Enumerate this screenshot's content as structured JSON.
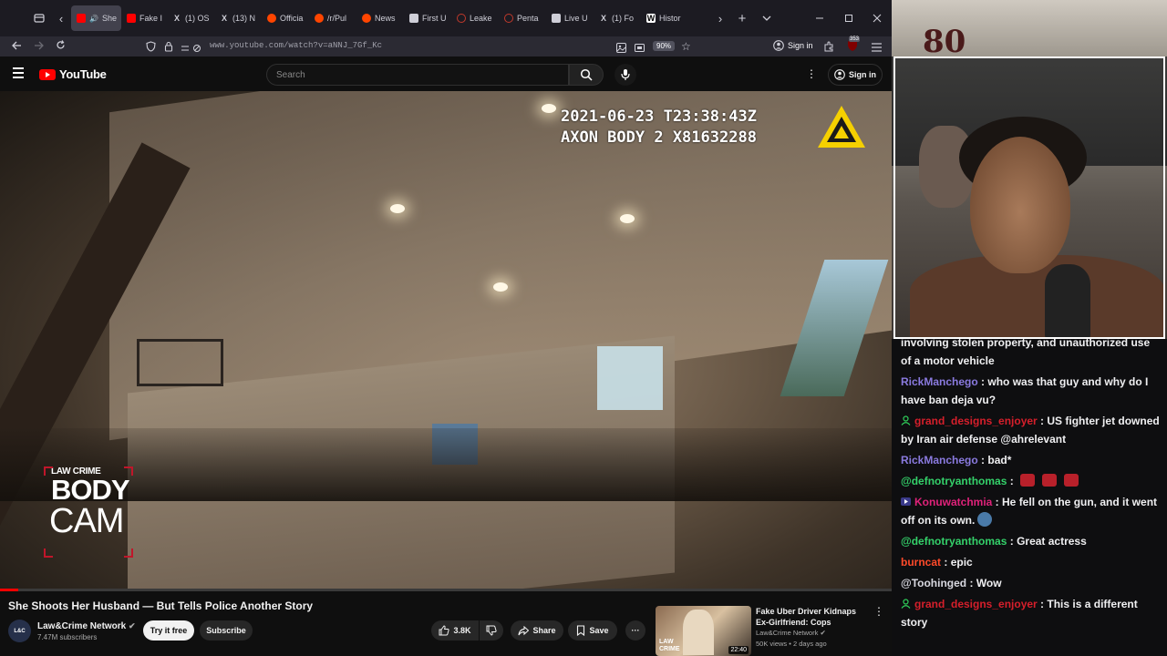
{
  "tabs": [
    {
      "label": "She",
      "favicon": "youtube-icon",
      "active": true
    },
    {
      "label": "Fake I",
      "favicon": "youtube-icon"
    },
    {
      "label": "(1) OS",
      "favicon": "x-icon"
    },
    {
      "label": "(13) N",
      "favicon": "x-icon"
    },
    {
      "label": "Officia",
      "favicon": "reddit-icon"
    },
    {
      "label": "/r/Pul",
      "favicon": "reddit-icon"
    },
    {
      "label": "News",
      "favicon": "reddit-icon"
    },
    {
      "label": "First U",
      "favicon": "page-icon"
    },
    {
      "label": "Leake",
      "favicon": "circle-icon"
    },
    {
      "label": "Penta",
      "favicon": "circle-icon"
    },
    {
      "label": "Live U",
      "favicon": "page-icon"
    },
    {
      "label": "(1) Fo",
      "favicon": "x-icon"
    },
    {
      "label": "Histor",
      "favicon": "wikipedia-icon"
    }
  ],
  "browser": {
    "url": "www.youtube.com/watch?v=aNNJ_7Gf_Kc",
    "zoom": "90%",
    "signin": "Sign in",
    "extension_badge": "353"
  },
  "youtube": {
    "logo_text": "YouTube",
    "search_placeholder": "Search",
    "signin": "Sign in"
  },
  "video": {
    "timestamp": "2021-06-23 T23:38:43Z",
    "device": "AXON BODY 2 X81632288",
    "watermark_brand": "LAW CRIME",
    "watermark_line1": "BODY",
    "watermark_line2": "CAM",
    "progress": 0.02,
    "title": "She Shoots Her Husband — But Tells Police Another Story",
    "channel": "Law&Crime Network",
    "subscribers": "7.47M subscribers",
    "try_it_free": "Try it free",
    "subscribe": "Subscribe",
    "likes": "3.8K",
    "share": "Share",
    "save": "Save"
  },
  "recommended": {
    "title": "Fake Uber Driver Kidnaps Ex-Girlfriend: Cops",
    "channel": "Law&Crime Network",
    "meta": "50K views • 2 days ago",
    "duration": "22:40",
    "thumb_brand_1": "LAW",
    "thumb_brand_2": "CRIME"
  },
  "webcam": {
    "decor_text": "80"
  },
  "chat": {
    "messages": [
      {
        "user": "",
        "color": "#efeff1",
        "text": "involving stolen property, and unauthorized use of a motor vehicle",
        "badge": ""
      },
      {
        "user": "RickManchego",
        "color": "#8a7adf",
        "text": "who was that guy and why do I have ban deja vu?",
        "badge": ""
      },
      {
        "user": "grand_designs_enjoyer",
        "color": "#d61f2b",
        "text": "US fighter jet downed by Iran air defense @ahrelevant",
        "badge": "green"
      },
      {
        "user": "RickManchego",
        "color": "#8a7adf",
        "text": "bad*",
        "badge": ""
      },
      {
        "user": "@defnotryanthomas",
        "color": "#34d16a",
        "text": "",
        "badge": "",
        "emotes": 3
      },
      {
        "user": "Konuwatchmia",
        "color": "#e0227a",
        "text": "He fell on the gun, and it went off on its own.",
        "badge": "purple",
        "emote_end": true
      },
      {
        "user": "@defnotryanthomas",
        "color": "#34d16a",
        "text": "Great actress",
        "badge": ""
      },
      {
        "user": "burncat",
        "color": "#ff4a2a",
        "text": "epic",
        "badge": ""
      },
      {
        "user": "@Toohinged",
        "color": "#d8d8e0",
        "text": "Wow",
        "badge": ""
      },
      {
        "user": "grand_designs_enjoyer",
        "color": "#d61f2b",
        "text": "This is a different story",
        "badge": "green"
      }
    ]
  },
  "colors": {
    "youtube_red": "#ff0000",
    "browser_tabbar": "#1c1b22",
    "chat_bg": "#0e0e10"
  }
}
